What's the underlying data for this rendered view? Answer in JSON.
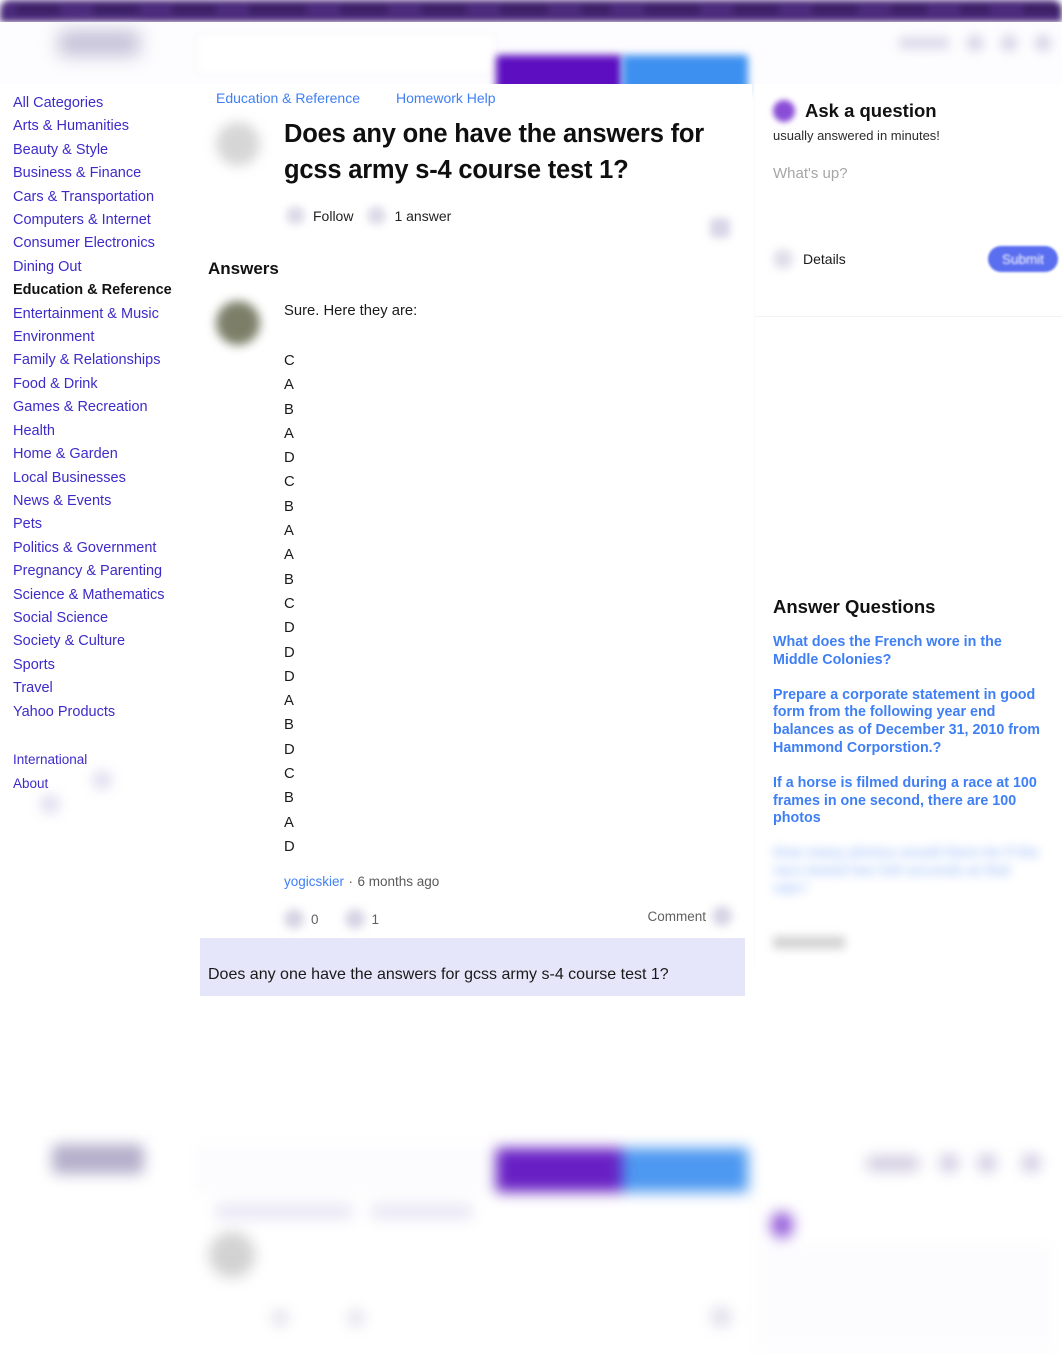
{
  "topnav": {
    "item_widths": [
      44,
      46,
      44,
      58,
      48,
      46,
      48,
      30,
      56,
      46,
      46,
      36,
      30,
      86
    ]
  },
  "header": {
    "search_placeholder": "",
    "primary_button_label": "",
    "secondary_button_label": ""
  },
  "sidebar": {
    "items": [
      {
        "label": "All Categories",
        "active": false
      },
      {
        "label": "Arts & Humanities",
        "active": false
      },
      {
        "label": "Beauty & Style",
        "active": false
      },
      {
        "label": "Business & Finance",
        "active": false
      },
      {
        "label": "Cars & Transportation",
        "active": false
      },
      {
        "label": "Computers & Internet",
        "active": false
      },
      {
        "label": "Consumer Electronics",
        "active": false
      },
      {
        "label": "Dining Out",
        "active": false
      },
      {
        "label": "Education & Reference",
        "active": true
      },
      {
        "label": "Entertainment & Music",
        "active": false
      },
      {
        "label": "Environment",
        "active": false
      },
      {
        "label": "Family & Relationships",
        "active": false
      },
      {
        "label": "Food & Drink",
        "active": false
      },
      {
        "label": "Games & Recreation",
        "active": false
      },
      {
        "label": "Health",
        "active": false
      },
      {
        "label": "Home & Garden",
        "active": false
      },
      {
        "label": "Local Businesses",
        "active": false
      },
      {
        "label": "News & Events",
        "active": false
      },
      {
        "label": "Pets",
        "active": false
      },
      {
        "label": "Politics & Government",
        "active": false
      },
      {
        "label": "Pregnancy & Parenting",
        "active": false
      },
      {
        "label": "Science & Mathematics",
        "active": false
      },
      {
        "label": "Social Science",
        "active": false
      },
      {
        "label": "Society & Culture",
        "active": false
      },
      {
        "label": "Sports",
        "active": false
      },
      {
        "label": "Travel",
        "active": false
      },
      {
        "label": "Yahoo Products",
        "active": false
      }
    ],
    "footer_items": [
      {
        "label": "International"
      },
      {
        "label": "About"
      }
    ]
  },
  "main": {
    "breadcrumb": [
      {
        "label": "Education & Reference"
      },
      {
        "label": "Homework Help"
      }
    ],
    "question": {
      "title": "Does any one have the answers for gcss army s-4 course test 1?",
      "follow_label": "Follow",
      "answer_count_label": "1 answer"
    },
    "answers_heading": "Answers",
    "answer": {
      "intro": "Sure. Here they are:",
      "letters": [
        "C",
        "A",
        "B",
        "A",
        "D",
        "C",
        "B",
        "A",
        "A",
        "B",
        "C",
        "D",
        "D",
        "D",
        "A",
        "B",
        "D",
        "C",
        "B",
        "A",
        "D"
      ],
      "author": "yogicskier",
      "separator": "·",
      "timestamp": "6 months ago",
      "upvote_count": "0",
      "downvote_count": "1",
      "comment_label": "Comment"
    },
    "related_question": "Does any one have the answers for gcss army s-4 course test 1?"
  },
  "rail": {
    "ask": {
      "title": "Ask a question",
      "subtitle": "usually answered in minutes!",
      "input_placeholder": "What's up?",
      "input_value": "",
      "details_label": "Details",
      "submit_label": "Submit"
    },
    "answer_questions": {
      "title": "Answer Questions",
      "items": [
        {
          "text": "What does the French wore in the Middle Colonies?",
          "blurred": false
        },
        {
          "text": "Prepare a corporate statement in good form from the following year end balances as of December 31, 2010 from Hammond Corporstion.?",
          "blurred": false
        },
        {
          "text": "If a horse is filmed during a race at 100 frames in one second, there are 100 photos",
          "blurred": false
        },
        {
          "text": "How many photos would there be if the race lasted two full seconds at that rate?",
          "blurred": true
        }
      ]
    }
  },
  "colors": {
    "topnav_purple": "#4c2b7d",
    "link_blue": "#3f7ff5",
    "sidebar_link": "#3d2bc9",
    "brand_purple": "#5c0ec0",
    "brand_blue": "#3e90f0",
    "submit_blue": "#5a6ef0",
    "highlight_lavender": "#e6e6fa",
    "text_dark": "#111111"
  }
}
